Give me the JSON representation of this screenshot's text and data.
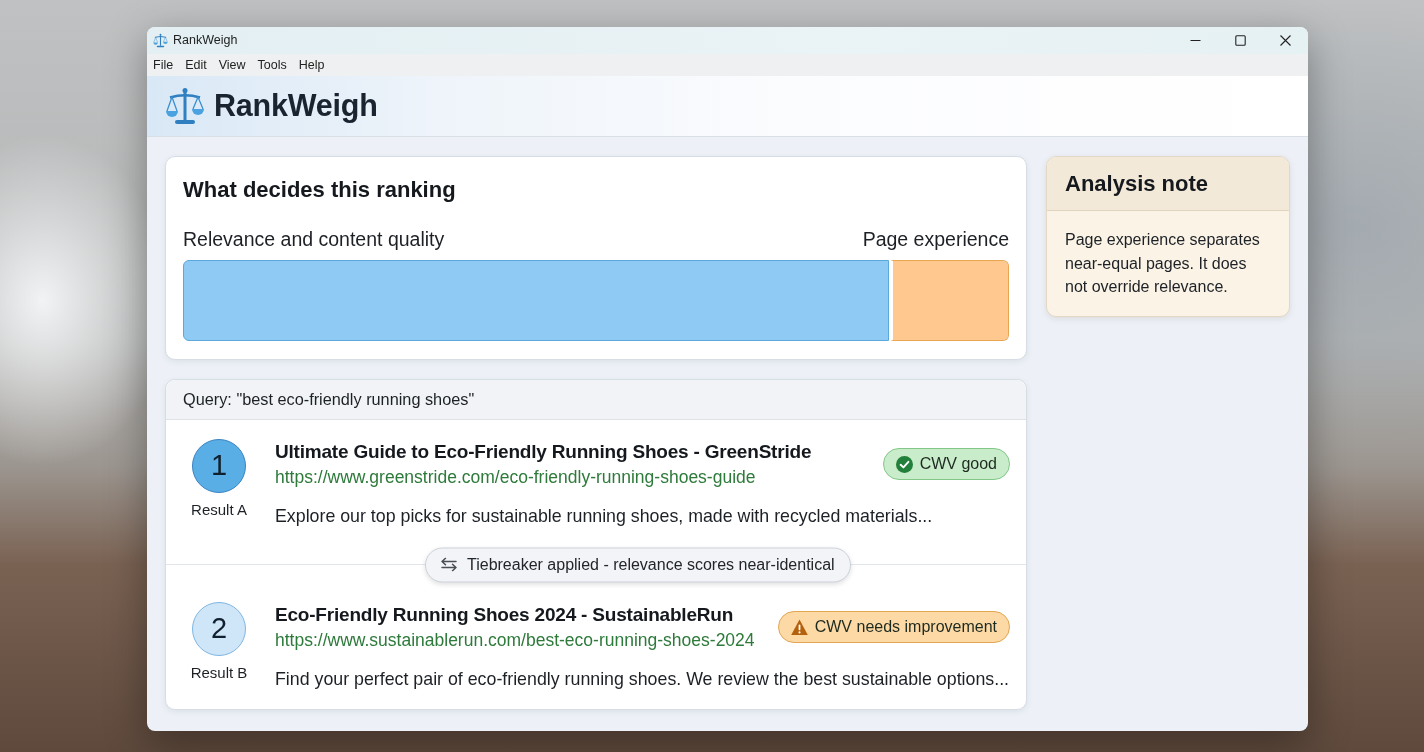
{
  "window": {
    "title": "RankWeigh"
  },
  "menu": [
    "File",
    "Edit",
    "View",
    "Tools",
    "Help"
  ],
  "app_header": {
    "title": "RankWeigh"
  },
  "ranking": {
    "title": "What decides this ranking",
    "segments": [
      {
        "label": "Relevance and content quality",
        "level": 0.855,
        "color": "#8ecaf4"
      },
      {
        "label": "Page experience",
        "level": 0.145,
        "color": "#fec88e"
      }
    ]
  },
  "results": {
    "query": "Query: \"best eco-friendly running shoes\"",
    "items": [
      {
        "rank": "1",
        "label": "Result A",
        "highlighted": true,
        "title": "Ultimate Guide to Eco-Friendly Running Shoes - GreenStride",
        "url": "https://www.greenstride.com/eco-friendly-running-shoes-guide",
        "snippet": "Explore our top picks for sustainable running shoes, made with recycled materials...",
        "status": {
          "kind": "good",
          "label": "CWV good"
        }
      },
      {
        "rank": "2",
        "label": "Result B",
        "highlighted": false,
        "title": "Eco-Friendly Running Shoes 2024 - SustainableRun",
        "url": "https://www.sustainablerun.com/best-eco-running-shoes-2024",
        "snippet": "Find your perfect pair of eco-friendly running shoes. We review the best sustainable options...",
        "status": {
          "kind": "warning",
          "label": "CWV needs improvement"
        }
      }
    ],
    "tiebreaker": {
      "label": "Tiebreaker applied - relevance scores near-identical"
    }
  },
  "note": {
    "title": "Analysis note",
    "text": "Page experience separates near-equal pages. It does not override relevance."
  }
}
